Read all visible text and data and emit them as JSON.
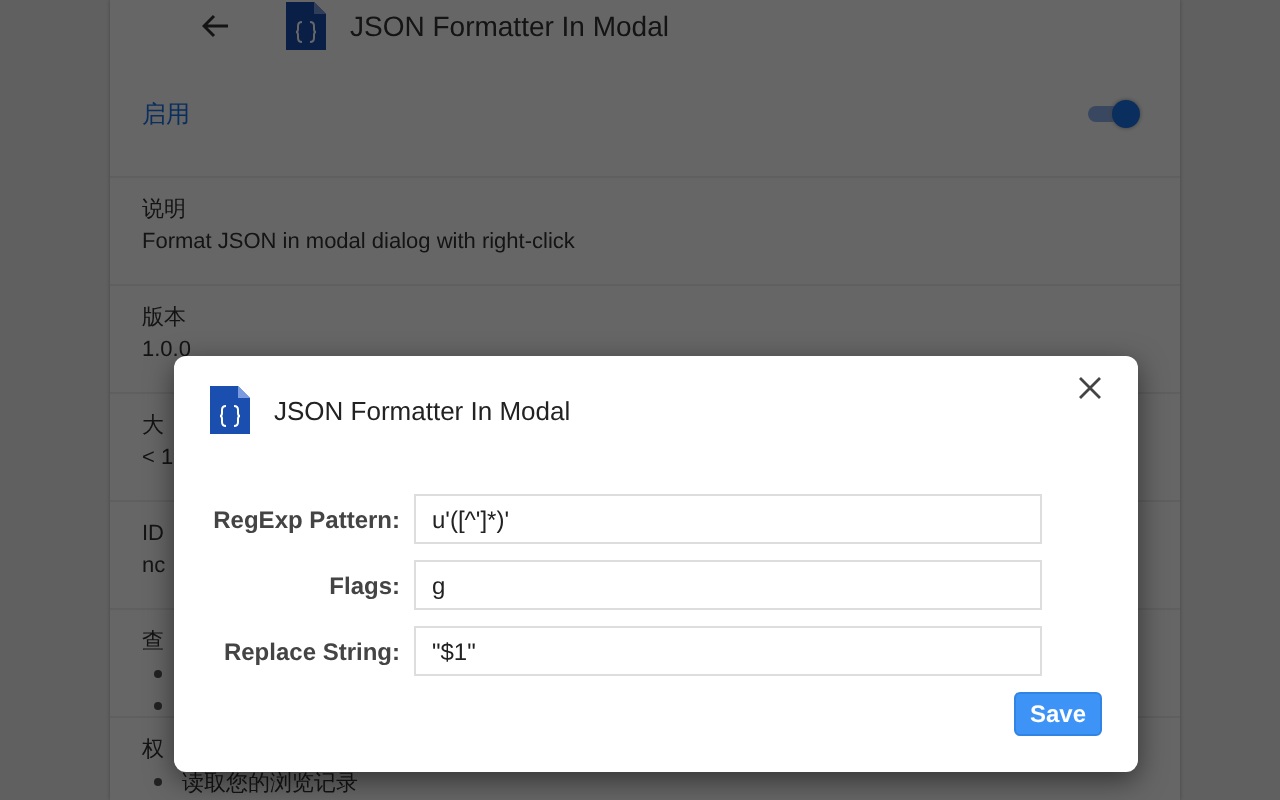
{
  "page": {
    "title": "JSON Formatter In Modal",
    "enabled": {
      "label": "启用",
      "on": true
    },
    "sections": [
      {
        "kind": "text",
        "label": "说明",
        "value": "Format JSON in modal dialog with right-click"
      },
      {
        "kind": "text",
        "label": "版本",
        "value": "1.0.0"
      },
      {
        "kind": "text",
        "label": "大",
        "value": "< 1"
      },
      {
        "kind": "text",
        "label": "ID",
        "value": "nc"
      },
      {
        "kind": "covered-list",
        "label": "查"
      },
      {
        "kind": "list",
        "label": "权",
        "items": [
          "读取您的浏览记录"
        ]
      }
    ]
  },
  "dialog": {
    "title": "JSON Formatter In Modal",
    "fields": [
      {
        "label": "RegExp Pattern:",
        "value": "u'([^']*)'"
      },
      {
        "label": "Flags:",
        "value": "g"
      },
      {
        "label": "Replace String:",
        "value": "\"$1\""
      }
    ],
    "save": "Save"
  }
}
